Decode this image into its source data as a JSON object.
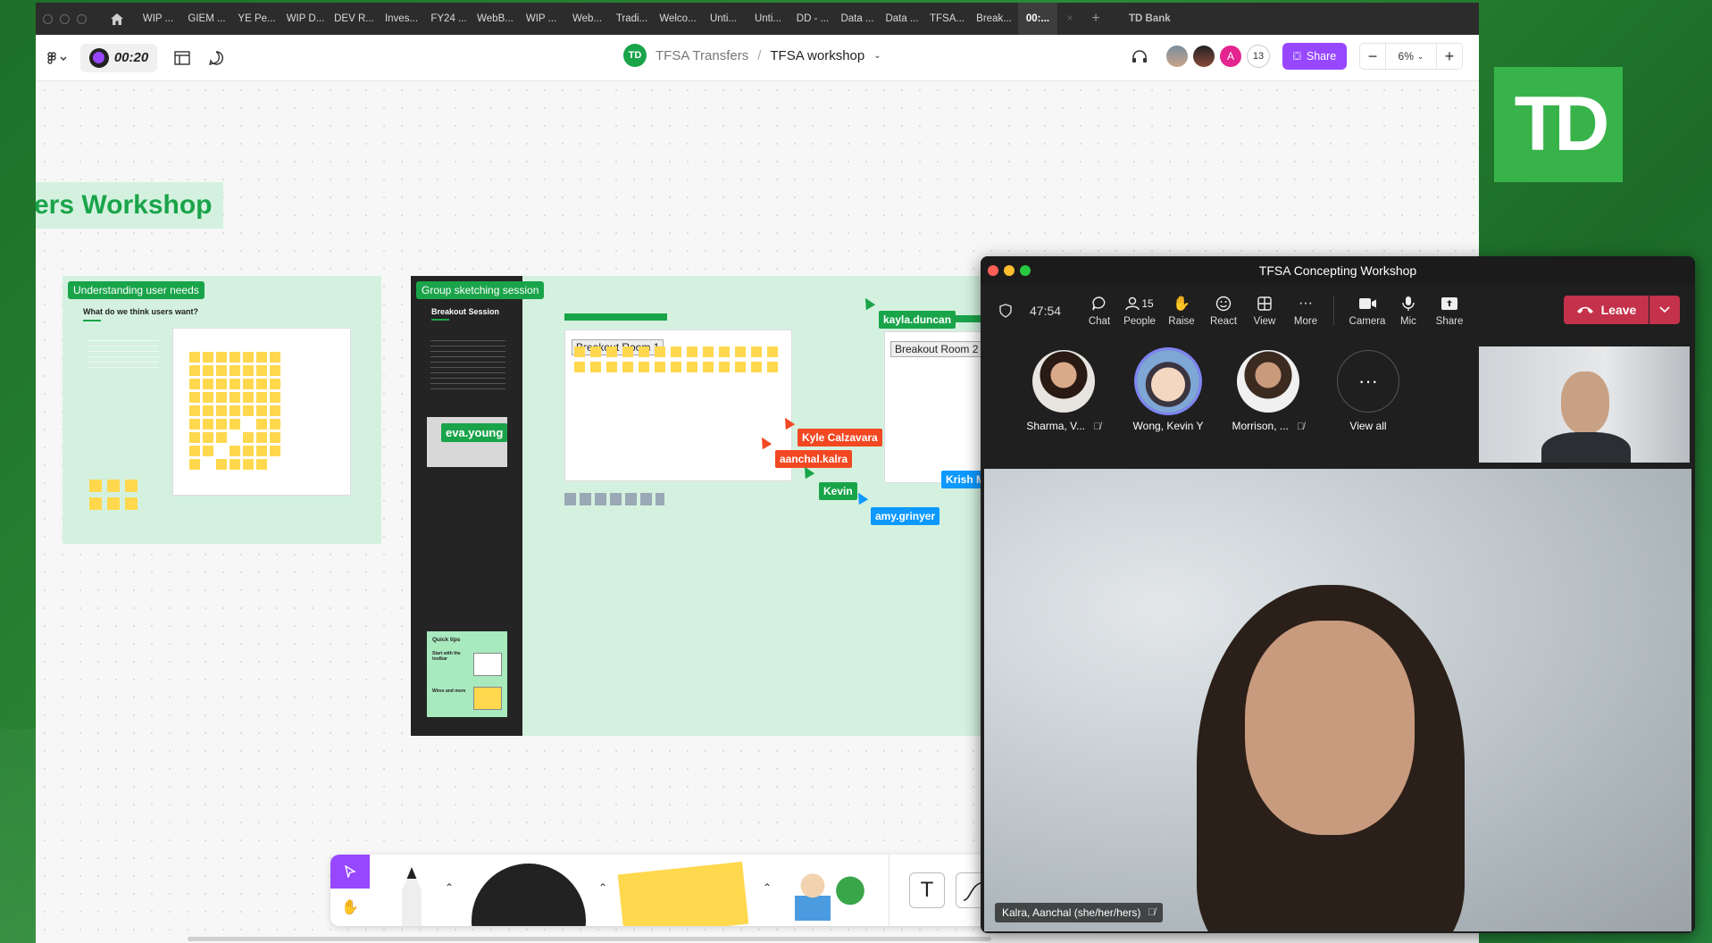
{
  "figma": {
    "tabs": [
      "WIP ...",
      "GIEM ...",
      "YE Pe...",
      "WIP D...",
      "DEV R...",
      "Inves...",
      "FY24 ...",
      "WebB...",
      "WIP ...",
      "Web...",
      "Tradi...",
      "Welco...",
      "Unti...",
      "Unti...",
      "DD - ...",
      "Data ...",
      "Data ...",
      "TFSA...",
      "Break...",
      "00:..."
    ],
    "new_tab": "+",
    "tab_close": "×",
    "account": "TD Bank",
    "timer": "00:20",
    "breadcrumb_project": "TFSA Transfers",
    "breadcrumb_sep": "/",
    "file_name": "TFSA workshop",
    "avatar_letter": "A",
    "collaborator_count": "13",
    "share_label": "Share",
    "zoom": "6%",
    "zoom_out": "−",
    "zoom_in": "+"
  },
  "canvas": {
    "workshop_title": "ers Workshop",
    "frame1_label": "Understanding user needs",
    "frame1_question": "What do we think users want?",
    "frame2_label": "Group sketching session",
    "frame2_heading": "Breakout Session",
    "breakout1": "Breakout Room 1",
    "breakout2": "Breakout Room 2",
    "quick_tips": "Quick tips",
    "tip1": "Start with the toolbar",
    "tip2": "Wires and more",
    "cursors": [
      {
        "name": "eva.young",
        "color": "#1aa44a"
      },
      {
        "name": "kayla.duncan",
        "color": "#1aa44a"
      },
      {
        "name": "Kyle Calzavara",
        "color": "#f24822"
      },
      {
        "name": "aanchal.kalra",
        "color": "#f24822"
      },
      {
        "name": "Kevin",
        "color": "#1aa44a"
      },
      {
        "name": "amy.grinyer",
        "color": "#0d99ff"
      },
      {
        "name": "Krish M",
        "color": "#0d99ff"
      }
    ]
  },
  "teams": {
    "title": "TFSA Concepting Workshop",
    "elapsed": "47:54",
    "controls": [
      {
        "label": "Chat",
        "icon": "chat-icon"
      },
      {
        "label": "People",
        "icon": "people-icon",
        "count": "15"
      },
      {
        "label": "Raise",
        "icon": "raise-hand-icon"
      },
      {
        "label": "React",
        "icon": "react-icon"
      },
      {
        "label": "View",
        "icon": "view-icon"
      },
      {
        "label": "More",
        "icon": "more-icon"
      },
      {
        "label": "Camera",
        "icon": "camera-icon"
      },
      {
        "label": "Mic",
        "icon": "mic-icon"
      },
      {
        "label": "Share",
        "icon": "share-icon"
      }
    ],
    "leave_label": "Leave",
    "participants": [
      {
        "name": "Sharma, V...",
        "muted": true
      },
      {
        "name": "Wong, Kevin Y",
        "muted": false
      },
      {
        "name": "Morrison, ...",
        "muted": true
      },
      {
        "name": "View all",
        "muted": false
      }
    ],
    "active_speaker": "Kalra, Aanchal (she/her/hers)"
  }
}
